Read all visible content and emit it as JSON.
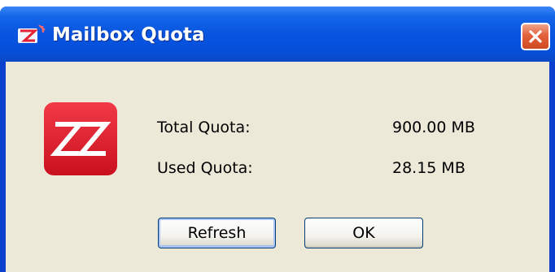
{
  "window": {
    "title": "Mailbox Quota",
    "title_icon": "zimbra-icon",
    "close_icon": "close-icon"
  },
  "content": {
    "app_icon": "zimbra-logo-icon",
    "total_quota_label": "Total Quota:",
    "total_quota_value": "900.00 MB",
    "used_quota_label": "Used Quota:",
    "used_quota_value": "28.15 MB"
  },
  "buttons": {
    "refresh_label": "Refresh",
    "ok_label": "OK"
  },
  "colors": {
    "titlebar": "#0550dc",
    "close_button": "#e2613b",
    "dialog_background": "#ece9d8",
    "app_icon_red": "#e52233"
  }
}
